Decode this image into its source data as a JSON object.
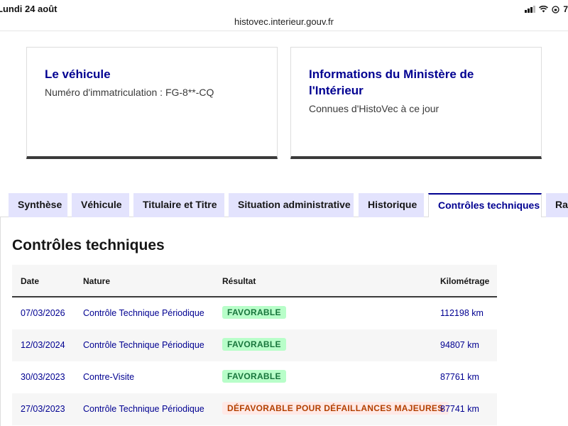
{
  "status_bar": {
    "time": "Lundi 24 août",
    "battery": "7"
  },
  "browser": {
    "url": "histovec.interieur.gouv.fr"
  },
  "cards": [
    {
      "title": "Le véhicule",
      "text": "Numéro d'immatriculation : FG-8**-CQ"
    },
    {
      "title": "Informations du Ministère de l'Intérieur",
      "text": "Connues d'HistoVec à ce jour"
    }
  ],
  "tabs": [
    {
      "label": "Synthèse",
      "active": false
    },
    {
      "label": "Véhicule",
      "active": false
    },
    {
      "label": "Titulaire et Titre",
      "active": false
    },
    {
      "label": "Situation administrative",
      "active": false
    },
    {
      "label": "Historique",
      "active": false
    },
    {
      "label": "Contrôles techniques",
      "active": true
    },
    {
      "label": "Rap",
      "active": false
    }
  ],
  "section": {
    "title": "Contrôles techniques"
  },
  "table": {
    "headers": {
      "date": "Date",
      "nature": "Nature",
      "result": "Résultat",
      "km": "Kilométrage"
    },
    "rows": [
      {
        "date": "07/03/2026",
        "nature": "Contrôle Technique Périodique",
        "result": "FAVORABLE",
        "status": "favorable",
        "km": "112198 km"
      },
      {
        "date": "12/03/2024",
        "nature": "Contrôle Technique Périodique",
        "result": "FAVORABLE",
        "status": "favorable",
        "km": "94807 km"
      },
      {
        "date": "30/03/2023",
        "nature": "Contre-Visite",
        "result": "FAVORABLE",
        "status": "favorable",
        "km": "87761 km"
      },
      {
        "date": "27/03/2023",
        "nature": "Contrôle Technique Périodique",
        "result": "DÉFAVORABLE POUR DÉFAILLANCES MAJEURES",
        "status": "defavorable",
        "km": "87741 km"
      }
    ]
  },
  "colors": {
    "primary": "#000091",
    "tab_background": "#e3e3fd",
    "favorable_bg": "#b8fec9",
    "favorable_text": "#18753c",
    "defavorable_bg": "#ffe9e6",
    "defavorable_text": "#b34000"
  }
}
